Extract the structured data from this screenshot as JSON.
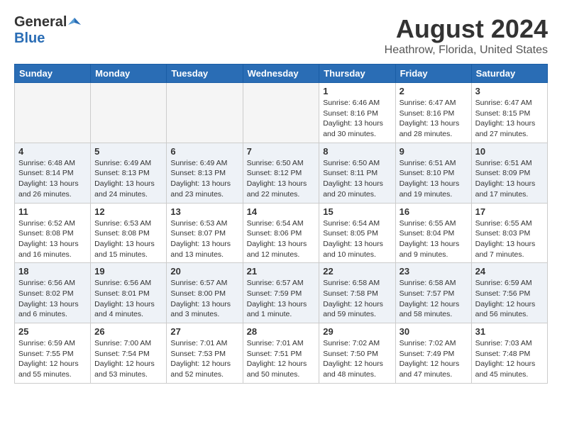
{
  "header": {
    "logo_general": "General",
    "logo_blue": "Blue",
    "month_title": "August 2024",
    "location": "Heathrow, Florida, United States"
  },
  "weekdays": [
    "Sunday",
    "Monday",
    "Tuesday",
    "Wednesday",
    "Thursday",
    "Friday",
    "Saturday"
  ],
  "weeks": [
    [
      {
        "day": "",
        "info": ""
      },
      {
        "day": "",
        "info": ""
      },
      {
        "day": "",
        "info": ""
      },
      {
        "day": "",
        "info": ""
      },
      {
        "day": "1",
        "info": "Sunrise: 6:46 AM\nSunset: 8:16 PM\nDaylight: 13 hours\nand 30 minutes."
      },
      {
        "day": "2",
        "info": "Sunrise: 6:47 AM\nSunset: 8:16 PM\nDaylight: 13 hours\nand 28 minutes."
      },
      {
        "day": "3",
        "info": "Sunrise: 6:47 AM\nSunset: 8:15 PM\nDaylight: 13 hours\nand 27 minutes."
      }
    ],
    [
      {
        "day": "4",
        "info": "Sunrise: 6:48 AM\nSunset: 8:14 PM\nDaylight: 13 hours\nand 26 minutes."
      },
      {
        "day": "5",
        "info": "Sunrise: 6:49 AM\nSunset: 8:13 PM\nDaylight: 13 hours\nand 24 minutes."
      },
      {
        "day": "6",
        "info": "Sunrise: 6:49 AM\nSunset: 8:13 PM\nDaylight: 13 hours\nand 23 minutes."
      },
      {
        "day": "7",
        "info": "Sunrise: 6:50 AM\nSunset: 8:12 PM\nDaylight: 13 hours\nand 22 minutes."
      },
      {
        "day": "8",
        "info": "Sunrise: 6:50 AM\nSunset: 8:11 PM\nDaylight: 13 hours\nand 20 minutes."
      },
      {
        "day": "9",
        "info": "Sunrise: 6:51 AM\nSunset: 8:10 PM\nDaylight: 13 hours\nand 19 minutes."
      },
      {
        "day": "10",
        "info": "Sunrise: 6:51 AM\nSunset: 8:09 PM\nDaylight: 13 hours\nand 17 minutes."
      }
    ],
    [
      {
        "day": "11",
        "info": "Sunrise: 6:52 AM\nSunset: 8:08 PM\nDaylight: 13 hours\nand 16 minutes."
      },
      {
        "day": "12",
        "info": "Sunrise: 6:53 AM\nSunset: 8:08 PM\nDaylight: 13 hours\nand 15 minutes."
      },
      {
        "day": "13",
        "info": "Sunrise: 6:53 AM\nSunset: 8:07 PM\nDaylight: 13 hours\nand 13 minutes."
      },
      {
        "day": "14",
        "info": "Sunrise: 6:54 AM\nSunset: 8:06 PM\nDaylight: 13 hours\nand 12 minutes."
      },
      {
        "day": "15",
        "info": "Sunrise: 6:54 AM\nSunset: 8:05 PM\nDaylight: 13 hours\nand 10 minutes."
      },
      {
        "day": "16",
        "info": "Sunrise: 6:55 AM\nSunset: 8:04 PM\nDaylight: 13 hours\nand 9 minutes."
      },
      {
        "day": "17",
        "info": "Sunrise: 6:55 AM\nSunset: 8:03 PM\nDaylight: 13 hours\nand 7 minutes."
      }
    ],
    [
      {
        "day": "18",
        "info": "Sunrise: 6:56 AM\nSunset: 8:02 PM\nDaylight: 13 hours\nand 6 minutes."
      },
      {
        "day": "19",
        "info": "Sunrise: 6:56 AM\nSunset: 8:01 PM\nDaylight: 13 hours\nand 4 minutes."
      },
      {
        "day": "20",
        "info": "Sunrise: 6:57 AM\nSunset: 8:00 PM\nDaylight: 13 hours\nand 3 minutes."
      },
      {
        "day": "21",
        "info": "Sunrise: 6:57 AM\nSunset: 7:59 PM\nDaylight: 13 hours\nand 1 minute."
      },
      {
        "day": "22",
        "info": "Sunrise: 6:58 AM\nSunset: 7:58 PM\nDaylight: 12 hours\nand 59 minutes."
      },
      {
        "day": "23",
        "info": "Sunrise: 6:58 AM\nSunset: 7:57 PM\nDaylight: 12 hours\nand 58 minutes."
      },
      {
        "day": "24",
        "info": "Sunrise: 6:59 AM\nSunset: 7:56 PM\nDaylight: 12 hours\nand 56 minutes."
      }
    ],
    [
      {
        "day": "25",
        "info": "Sunrise: 6:59 AM\nSunset: 7:55 PM\nDaylight: 12 hours\nand 55 minutes."
      },
      {
        "day": "26",
        "info": "Sunrise: 7:00 AM\nSunset: 7:54 PM\nDaylight: 12 hours\nand 53 minutes."
      },
      {
        "day": "27",
        "info": "Sunrise: 7:01 AM\nSunset: 7:53 PM\nDaylight: 12 hours\nand 52 minutes."
      },
      {
        "day": "28",
        "info": "Sunrise: 7:01 AM\nSunset: 7:51 PM\nDaylight: 12 hours\nand 50 minutes."
      },
      {
        "day": "29",
        "info": "Sunrise: 7:02 AM\nSunset: 7:50 PM\nDaylight: 12 hours\nand 48 minutes."
      },
      {
        "day": "30",
        "info": "Sunrise: 7:02 AM\nSunset: 7:49 PM\nDaylight: 12 hours\nand 47 minutes."
      },
      {
        "day": "31",
        "info": "Sunrise: 7:03 AM\nSunset: 7:48 PM\nDaylight: 12 hours\nand 45 minutes."
      }
    ]
  ]
}
